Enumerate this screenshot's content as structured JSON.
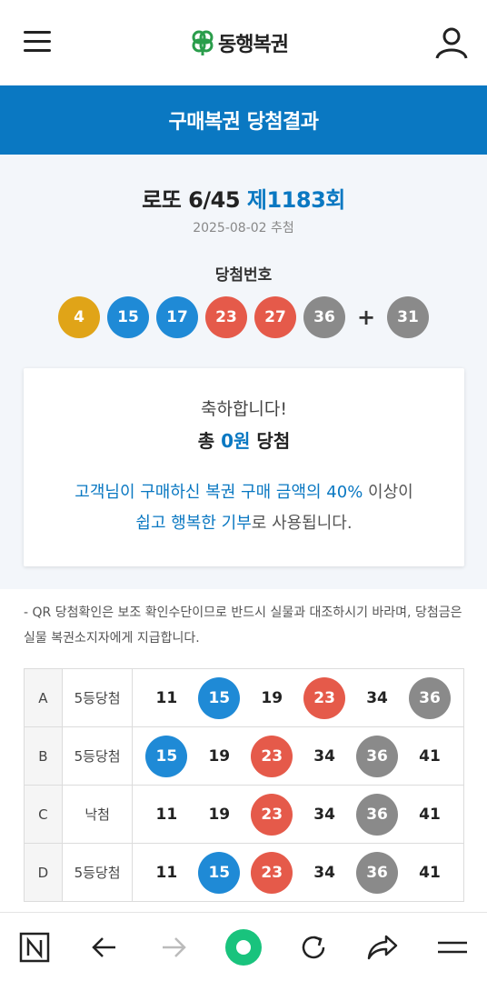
{
  "header": {
    "logo_text": "동행복권",
    "menu_icon": "hamburger-icon",
    "user_icon": "user-icon"
  },
  "banner": {
    "title": "구매복권 당첨결과"
  },
  "draw": {
    "game": "로또 6/45",
    "round": "제1183회",
    "date": "2025-08-02 추첨",
    "label": "당첨번호",
    "numbers": [
      {
        "value": "4",
        "color": "#e0a418"
      },
      {
        "value": "15",
        "color": "#1f8ad6"
      },
      {
        "value": "17",
        "color": "#1f8ad6"
      },
      {
        "value": "23",
        "color": "#e55a4a"
      },
      {
        "value": "27",
        "color": "#e55a4a"
      },
      {
        "value": "36",
        "color": "#8a8a8a"
      }
    ],
    "plus": "+",
    "bonus": {
      "value": "31",
      "color": "#8a8a8a"
    }
  },
  "congrats": {
    "line1": "축하합니다!",
    "total_prefix": "총",
    "amount": "0원",
    "total_suffix": "당첨",
    "msg_part1": "고객님이 구매하신 복권 구매 금액의 40%",
    "msg_part2": " 이상이",
    "msg_part3": "쉽고 행복한 기부",
    "msg_part4": "로 사용됩니다."
  },
  "notice": "- QR 당첨확인은 보조 확인수단이므로 반드시 실물과 대조하시기 바라며, 당첨금은 실물 복권소지자에게 지급합니다.",
  "tickets": [
    {
      "letter": "A",
      "status": "5등당첨",
      "numbers": [
        {
          "v": "11",
          "c": ""
        },
        {
          "v": "15",
          "c": "blue"
        },
        {
          "v": "19",
          "c": ""
        },
        {
          "v": "23",
          "c": "red"
        },
        {
          "v": "34",
          "c": ""
        },
        {
          "v": "36",
          "c": "gray"
        }
      ]
    },
    {
      "letter": "B",
      "status": "5등당첨",
      "numbers": [
        {
          "v": "15",
          "c": "blue"
        },
        {
          "v": "19",
          "c": ""
        },
        {
          "v": "23",
          "c": "red"
        },
        {
          "v": "34",
          "c": ""
        },
        {
          "v": "36",
          "c": "gray"
        },
        {
          "v": "41",
          "c": ""
        }
      ]
    },
    {
      "letter": "C",
      "status": "낙첨",
      "numbers": [
        {
          "v": "11",
          "c": ""
        },
        {
          "v": "19",
          "c": ""
        },
        {
          "v": "23",
          "c": "red"
        },
        {
          "v": "34",
          "c": ""
        },
        {
          "v": "36",
          "c": "gray"
        },
        {
          "v": "41",
          "c": ""
        }
      ]
    },
    {
      "letter": "D",
      "status": "5등당첨",
      "numbers": [
        {
          "v": "11",
          "c": ""
        },
        {
          "v": "15",
          "c": "blue"
        },
        {
          "v": "23",
          "c": "red"
        },
        {
          "v": "34",
          "c": ""
        },
        {
          "v": "36",
          "c": "gray"
        },
        {
          "v": "41",
          "c": ""
        }
      ]
    }
  ],
  "nav": {
    "icons": [
      "n-logo-icon",
      "back-arrow-icon",
      "forward-arrow-icon",
      "home-circle-icon",
      "refresh-icon",
      "share-icon",
      "menu-icon"
    ],
    "accent": "#19c37d"
  }
}
